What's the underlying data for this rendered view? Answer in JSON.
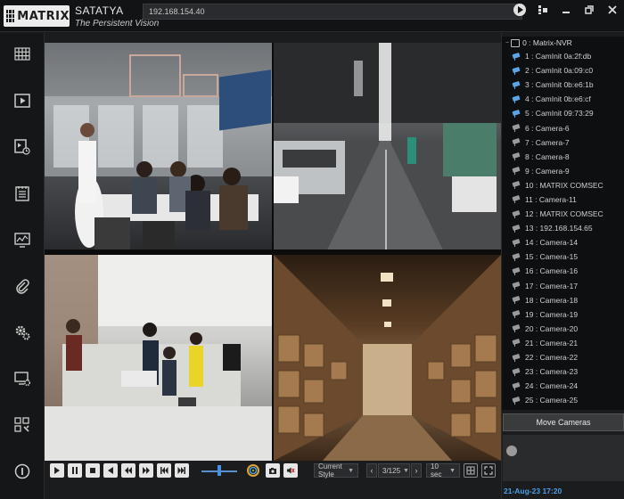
{
  "header": {
    "logo_text": "MATRIX",
    "brand_name": "SATATYA",
    "brand_tagline": "The Persistent Vision",
    "address": "192.168.154.40"
  },
  "sidebar": {
    "items": [
      "grid-layout",
      "playback",
      "event-search",
      "reports",
      "system-monitor",
      "attachments",
      "settings",
      "display-settings",
      "tools",
      "info"
    ]
  },
  "controls": {
    "style_select": "Current Style",
    "page_value": "3/125",
    "interval_select": "10 sec"
  },
  "tree": {
    "root": "0 : Matrix-NVR",
    "cameras": [
      "1 : CamInit 0a:2f:db",
      "2 : CamInit 0a:09:c0",
      "3 : CamInit 0b:e6:1b",
      "4 : CamInit 0b:e6:cf",
      "5 : CamInit 09:73:29",
      "6 : Camera-6",
      "7 : Camera-7",
      "8 : Camera-8",
      "9 : Camera-9",
      "10 : MATRIX COMSEC",
      "11 : Camera-11",
      "12 : MATRIX COMSEC",
      "13 : 192.168.154.65",
      "14 : Camera-14",
      "15 : Camera-15",
      "16 : Camera-16",
      "17 : Camera-17",
      "18 : Camera-18",
      "19 : Camera-19",
      "20 : Camera-20",
      "21 : Camera-21",
      "22 : Camera-22",
      "23 : Camera-23",
      "24 : Camera-24",
      "25 : Camera-25"
    ]
  },
  "move_cameras_label": "Move Cameras",
  "datetime": "21-Aug-23 17:20"
}
